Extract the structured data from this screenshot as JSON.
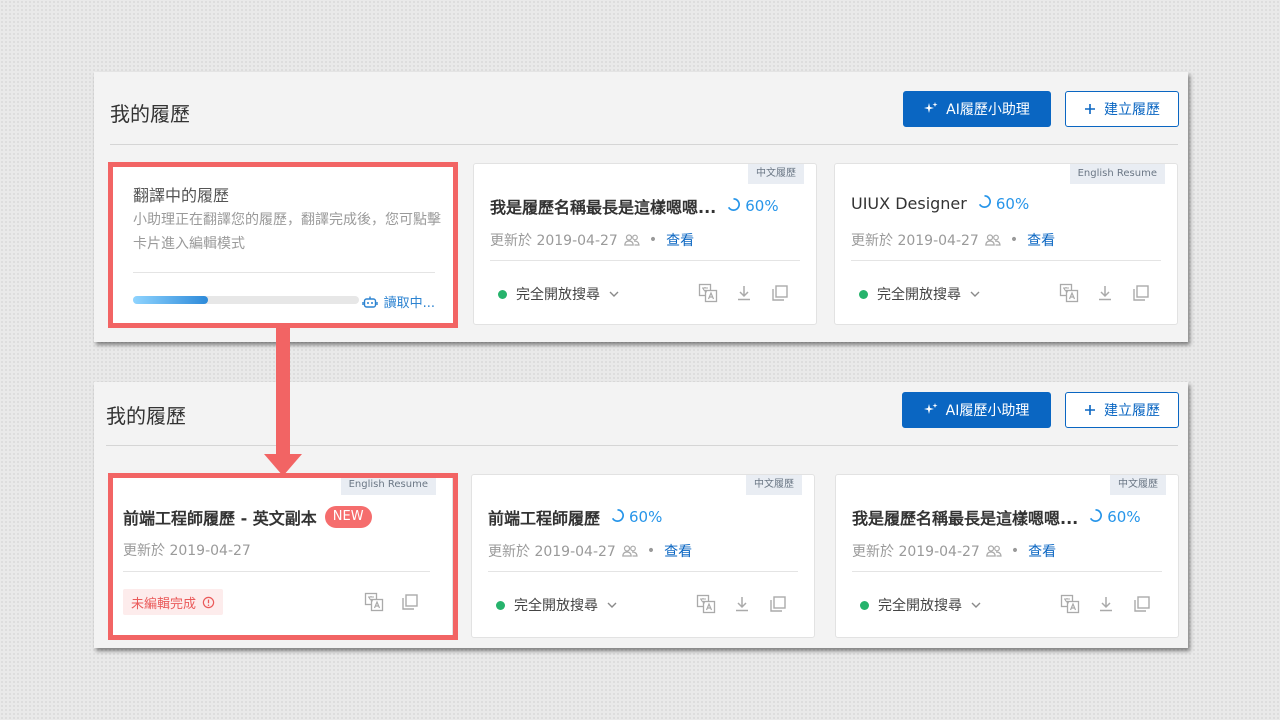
{
  "panel_top": {
    "title": "我的履歷",
    "ai_button": "AI履歷小助理",
    "create_button": "建立履歷",
    "translating_card": {
      "title": "翻譯中的履歷",
      "description": "小助理正在翻譯您的履歷，翻譯完成後，您可點擊卡片進入編輯模式",
      "progress": 0.33,
      "status": "讀取中..."
    },
    "cards": [
      {
        "tag": "中文履歷",
        "title": "我是履歷名稱最長是這樣嗯嗯...",
        "percent": "60%",
        "updated": "更新於 2019-04-27",
        "view": "查看",
        "status": "完全開放搜尋"
      },
      {
        "tag": "English Resume",
        "title": "UIUX Designer",
        "percent": "60%",
        "updated": "更新於 2019-04-27",
        "view": "查看",
        "status": "完全開放搜尋"
      }
    ]
  },
  "panel_bottom": {
    "title": "我的履歷",
    "ai_button": "AI履歷小助理",
    "create_button": "建立履歷",
    "new_card": {
      "tag": "English Resume",
      "title": "前端工程師履歷 - 英文副本",
      "badge": "NEW",
      "updated": "更新於 2019-04-27",
      "state": "未編輯完成"
    },
    "cards": [
      {
        "tag": "中文履歷",
        "title": "前端工程師履歷",
        "percent": "60%",
        "updated": "更新於 2019-04-27",
        "view": "查看",
        "status": "完全開放搜尋"
      },
      {
        "tag": "中文履歷",
        "title": "我是履歷名稱最長是這樣嗯嗯...",
        "percent": "60%",
        "updated": "更新於 2019-04-27",
        "view": "查看",
        "status": "完全開放搜尋"
      }
    ]
  },
  "colors": {
    "primary": "#0a66c2",
    "highlight": "#f26464",
    "success": "#26b36c",
    "progress": "#2795e9"
  },
  "icons": [
    "sparkle-icon",
    "plus-icon",
    "robot-icon",
    "spinner-icon",
    "people-icon",
    "chevron-down-icon",
    "translate-icon",
    "download-icon",
    "copy-icon",
    "alert-circle-icon"
  ]
}
